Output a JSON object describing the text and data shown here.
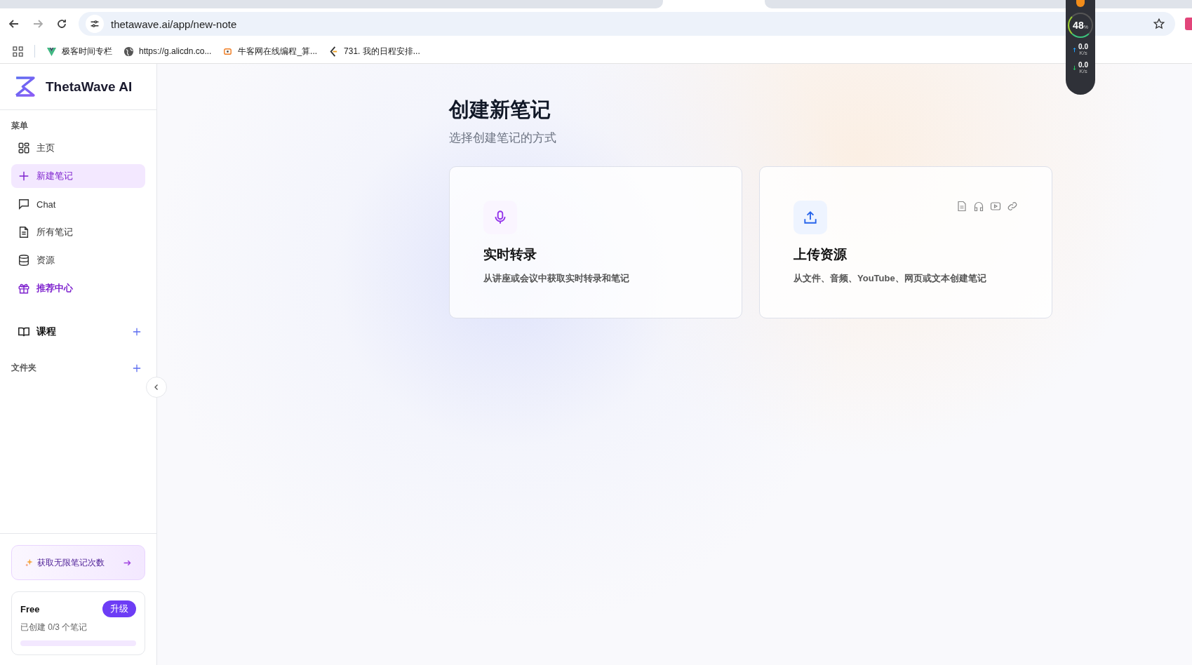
{
  "browser": {
    "url": "thetawave.ai/app/new-note",
    "bookmarks": [
      {
        "label": "极客时间专栏"
      },
      {
        "label": "https://g.alicdn.co..."
      },
      {
        "label": "牛客网在线编程_算..."
      },
      {
        "label": "731. 我的日程安排..."
      }
    ]
  },
  "monitor": {
    "percent": "48",
    "percent_unit": "%",
    "up": "0.0",
    "up_unit": "K/s",
    "down": "0.0",
    "down_unit": "K/s"
  },
  "sidebar": {
    "brand": "ThetaWave AI",
    "menu_label": "菜单",
    "items": [
      {
        "label": "主页",
        "selected": false,
        "kind": "normal"
      },
      {
        "label": "新建笔记",
        "selected": true,
        "kind": "normal"
      },
      {
        "label": "Chat",
        "selected": false,
        "kind": "normal"
      },
      {
        "label": "所有笔记",
        "selected": false,
        "kind": "normal"
      },
      {
        "label": "资源",
        "selected": false,
        "kind": "normal"
      },
      {
        "label": "推荐中心",
        "selected": false,
        "kind": "promo"
      }
    ],
    "courses_label": "课程",
    "folders_label": "文件夹",
    "promo": "获取无限笔记次数",
    "plan": {
      "name": "Free",
      "upgrade": "升级",
      "usage": "已创建 0/3 个笔记",
      "level": 0
    }
  },
  "main": {
    "title": "创建新笔记",
    "subtitle": "选择创建笔记的方式",
    "cards": [
      {
        "kind": "record",
        "title": "实时转录",
        "description": "从讲座或会议中获取实时转录和笔记"
      },
      {
        "kind": "upload",
        "title": "上传资源",
        "description": "从文件、音频、YouTube、网页或文本创建笔记"
      }
    ]
  }
}
